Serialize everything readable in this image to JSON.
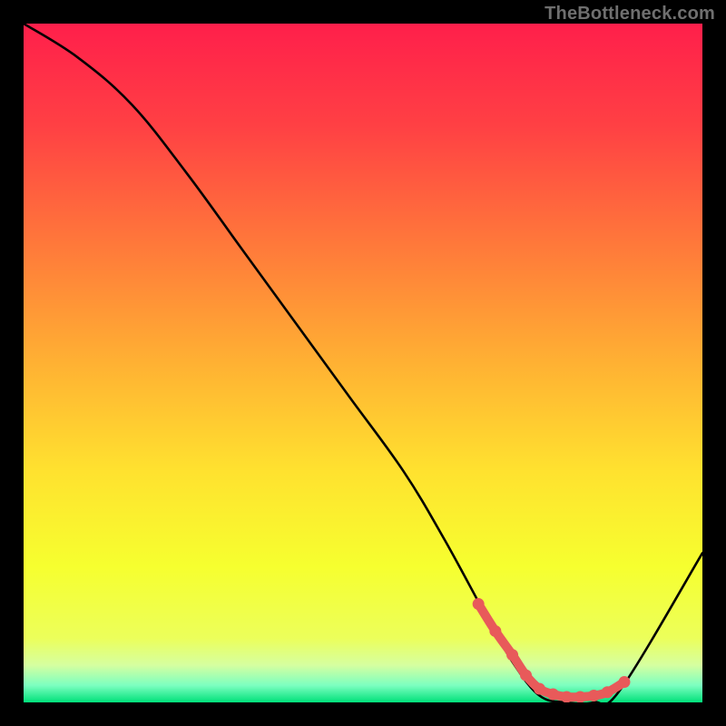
{
  "watermark": "TheBottleneck.com",
  "colors": {
    "page_bg": "#000000",
    "curve": "#000000",
    "marker": "#e85a5a",
    "gradient_stops": [
      {
        "offset": 0.0,
        "color": "#ff1f4b"
      },
      {
        "offset": 0.15,
        "color": "#ff4044"
      },
      {
        "offset": 0.33,
        "color": "#ff7a3a"
      },
      {
        "offset": 0.5,
        "color": "#ffb133"
      },
      {
        "offset": 0.66,
        "color": "#ffe22f"
      },
      {
        "offset": 0.8,
        "color": "#f6ff2f"
      },
      {
        "offset": 0.905,
        "color": "#ecff5a"
      },
      {
        "offset": 0.945,
        "color": "#d6ffa0"
      },
      {
        "offset": 0.975,
        "color": "#7cffc0"
      },
      {
        "offset": 1.0,
        "color": "#00e07a"
      }
    ]
  },
  "chart_data": {
    "type": "line",
    "title": "",
    "xlabel": "",
    "ylabel": "",
    "xlim": [
      0,
      100
    ],
    "ylim": [
      0,
      100
    ],
    "series": [
      {
        "name": "bottleneck-curve",
        "x": [
          0,
          8,
          16,
          24,
          32,
          40,
          48,
          56,
          62,
          68,
          72,
          76,
          80,
          84,
          88,
          100
        ],
        "y": [
          100,
          95,
          88,
          78,
          67,
          56,
          45,
          34,
          24,
          13,
          6,
          1,
          0,
          0,
          2,
          22
        ]
      }
    ],
    "highlight": {
      "name": "optimal-range",
      "x": [
        67.0,
        69.5,
        72.0,
        74.0,
        76.0,
        78.0,
        80.0,
        82.0,
        84.0,
        86.0,
        88.5
      ],
      "y": [
        14.5,
        10.5,
        7.0,
        4.0,
        2.0,
        1.2,
        0.8,
        0.8,
        1.0,
        1.5,
        3.0
      ]
    }
  }
}
